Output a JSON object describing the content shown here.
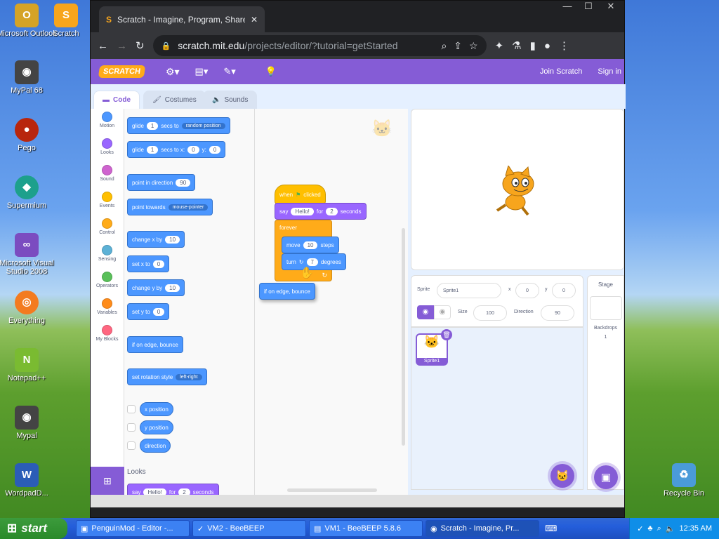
{
  "desktop": {
    "icons": [
      {
        "label": "Microsoft Outlook",
        "glyph": "O",
        "color": "#d5a326"
      },
      {
        "label": "Scratch",
        "glyph": "S",
        "color": "#f7a51d"
      },
      {
        "label": "MyPal 68",
        "glyph": "◉",
        "color": "#444"
      },
      {
        "label": "Pego",
        "glyph": "●",
        "color": "#b8260d"
      },
      {
        "label": "Supermium",
        "glyph": "◆",
        "color": "#1da08c"
      },
      {
        "label": "Microsoft Visual Studio 2008",
        "glyph": "∞",
        "color": "#7b4cc0"
      },
      {
        "label": "Everything",
        "glyph": "◎",
        "color": "#f37b20"
      },
      {
        "label": "Notepad++",
        "glyph": "N",
        "color": "#7abb31"
      },
      {
        "label": "Mypal",
        "glyph": "◉",
        "color": "#444"
      },
      {
        "label": "WordpadD...",
        "glyph": "W",
        "color": "#2b5db7"
      },
      {
        "label": "Recycle Bin",
        "glyph": "♻",
        "color": "#4a9bd9"
      }
    ]
  },
  "browser": {
    "tab_title": "Scratch - Imagine, Program, Share",
    "url_host": "scratch.mit.edu",
    "url_path": "/projects/editor/?tutorial=getStarted"
  },
  "menubar": {
    "logo": "SCRATCH",
    "join": "Join Scratch",
    "signin": "Sign in"
  },
  "editor_tabs": {
    "code": "Code",
    "costumes": "Costumes",
    "sounds": "Sounds"
  },
  "categories": [
    {
      "label": "Motion",
      "color": "#4c97ff"
    },
    {
      "label": "Looks",
      "color": "#9966ff"
    },
    {
      "label": "Sound",
      "color": "#cf63cf"
    },
    {
      "label": "Events",
      "color": "#ffbf00"
    },
    {
      "label": "Control",
      "color": "#ffab19"
    },
    {
      "label": "Sensing",
      "color": "#5cb1d6"
    },
    {
      "label": "Operators",
      "color": "#59c059"
    },
    {
      "label": "Variables",
      "color": "#ff8c1a"
    },
    {
      "label": "My Blocks",
      "color": "#ff6680"
    }
  ],
  "palette": {
    "glide1": {
      "a": "glide",
      "n": "1",
      "b": "secs to",
      "dd": "random position"
    },
    "glide2": {
      "a": "glide",
      "n": "1",
      "b": "secs to x:",
      "x": "0",
      "c": "y:",
      "y": "0"
    },
    "point_dir": {
      "a": "point in direction",
      "n": "90"
    },
    "point_towards": {
      "a": "point towards",
      "dd": "mouse-pointer"
    },
    "change_x": {
      "a": "change x by",
      "n": "10"
    },
    "set_x": {
      "a": "set x to",
      "n": "0"
    },
    "change_y": {
      "a": "change y by",
      "n": "10"
    },
    "set_y": {
      "a": "set y to",
      "n": "0"
    },
    "bounce": "if on edge, bounce",
    "rotation": {
      "a": "set rotation style",
      "dd": "left-right"
    },
    "xpos": "x position",
    "ypos": "y position",
    "direction": "direction",
    "looks_header": "Looks",
    "say": {
      "a": "say",
      "msg": "Hello!",
      "b": "for",
      "n": "2",
      "c": "seconds"
    }
  },
  "script": {
    "when": "when",
    "clicked": "clicked",
    "say": {
      "a": "say",
      "msg": "Hello!",
      "b": "for",
      "n": "2",
      "c": "seconds"
    },
    "forever": "forever",
    "move": {
      "a": "move",
      "n": "10",
      "b": "steps"
    },
    "turn": {
      "a": "turn",
      "n": "7",
      "b": "degrees"
    },
    "dragging": "if on edge, bounce"
  },
  "sprite": {
    "sprite_label": "Sprite",
    "name": "Sprite1",
    "x_label": "x",
    "x": "0",
    "y_label": "y",
    "y": "0",
    "show_label": "Show",
    "size_label": "Size",
    "size": "100",
    "dir_label": "Direction",
    "dir": "90",
    "thumb_label": "Sprite1"
  },
  "stage_panel": {
    "title": "Stage",
    "backdrops_label": "Backdrops",
    "backdrops": "1"
  },
  "taskbar": {
    "start": "start",
    "tasks": [
      "PenguinMod - Editor -...",
      "VM2 - BeeBEEP",
      "VM1 - BeeBEEP 5.8.6",
      "Scratch - Imagine, Pr..."
    ],
    "clock": "12:35 AM"
  }
}
